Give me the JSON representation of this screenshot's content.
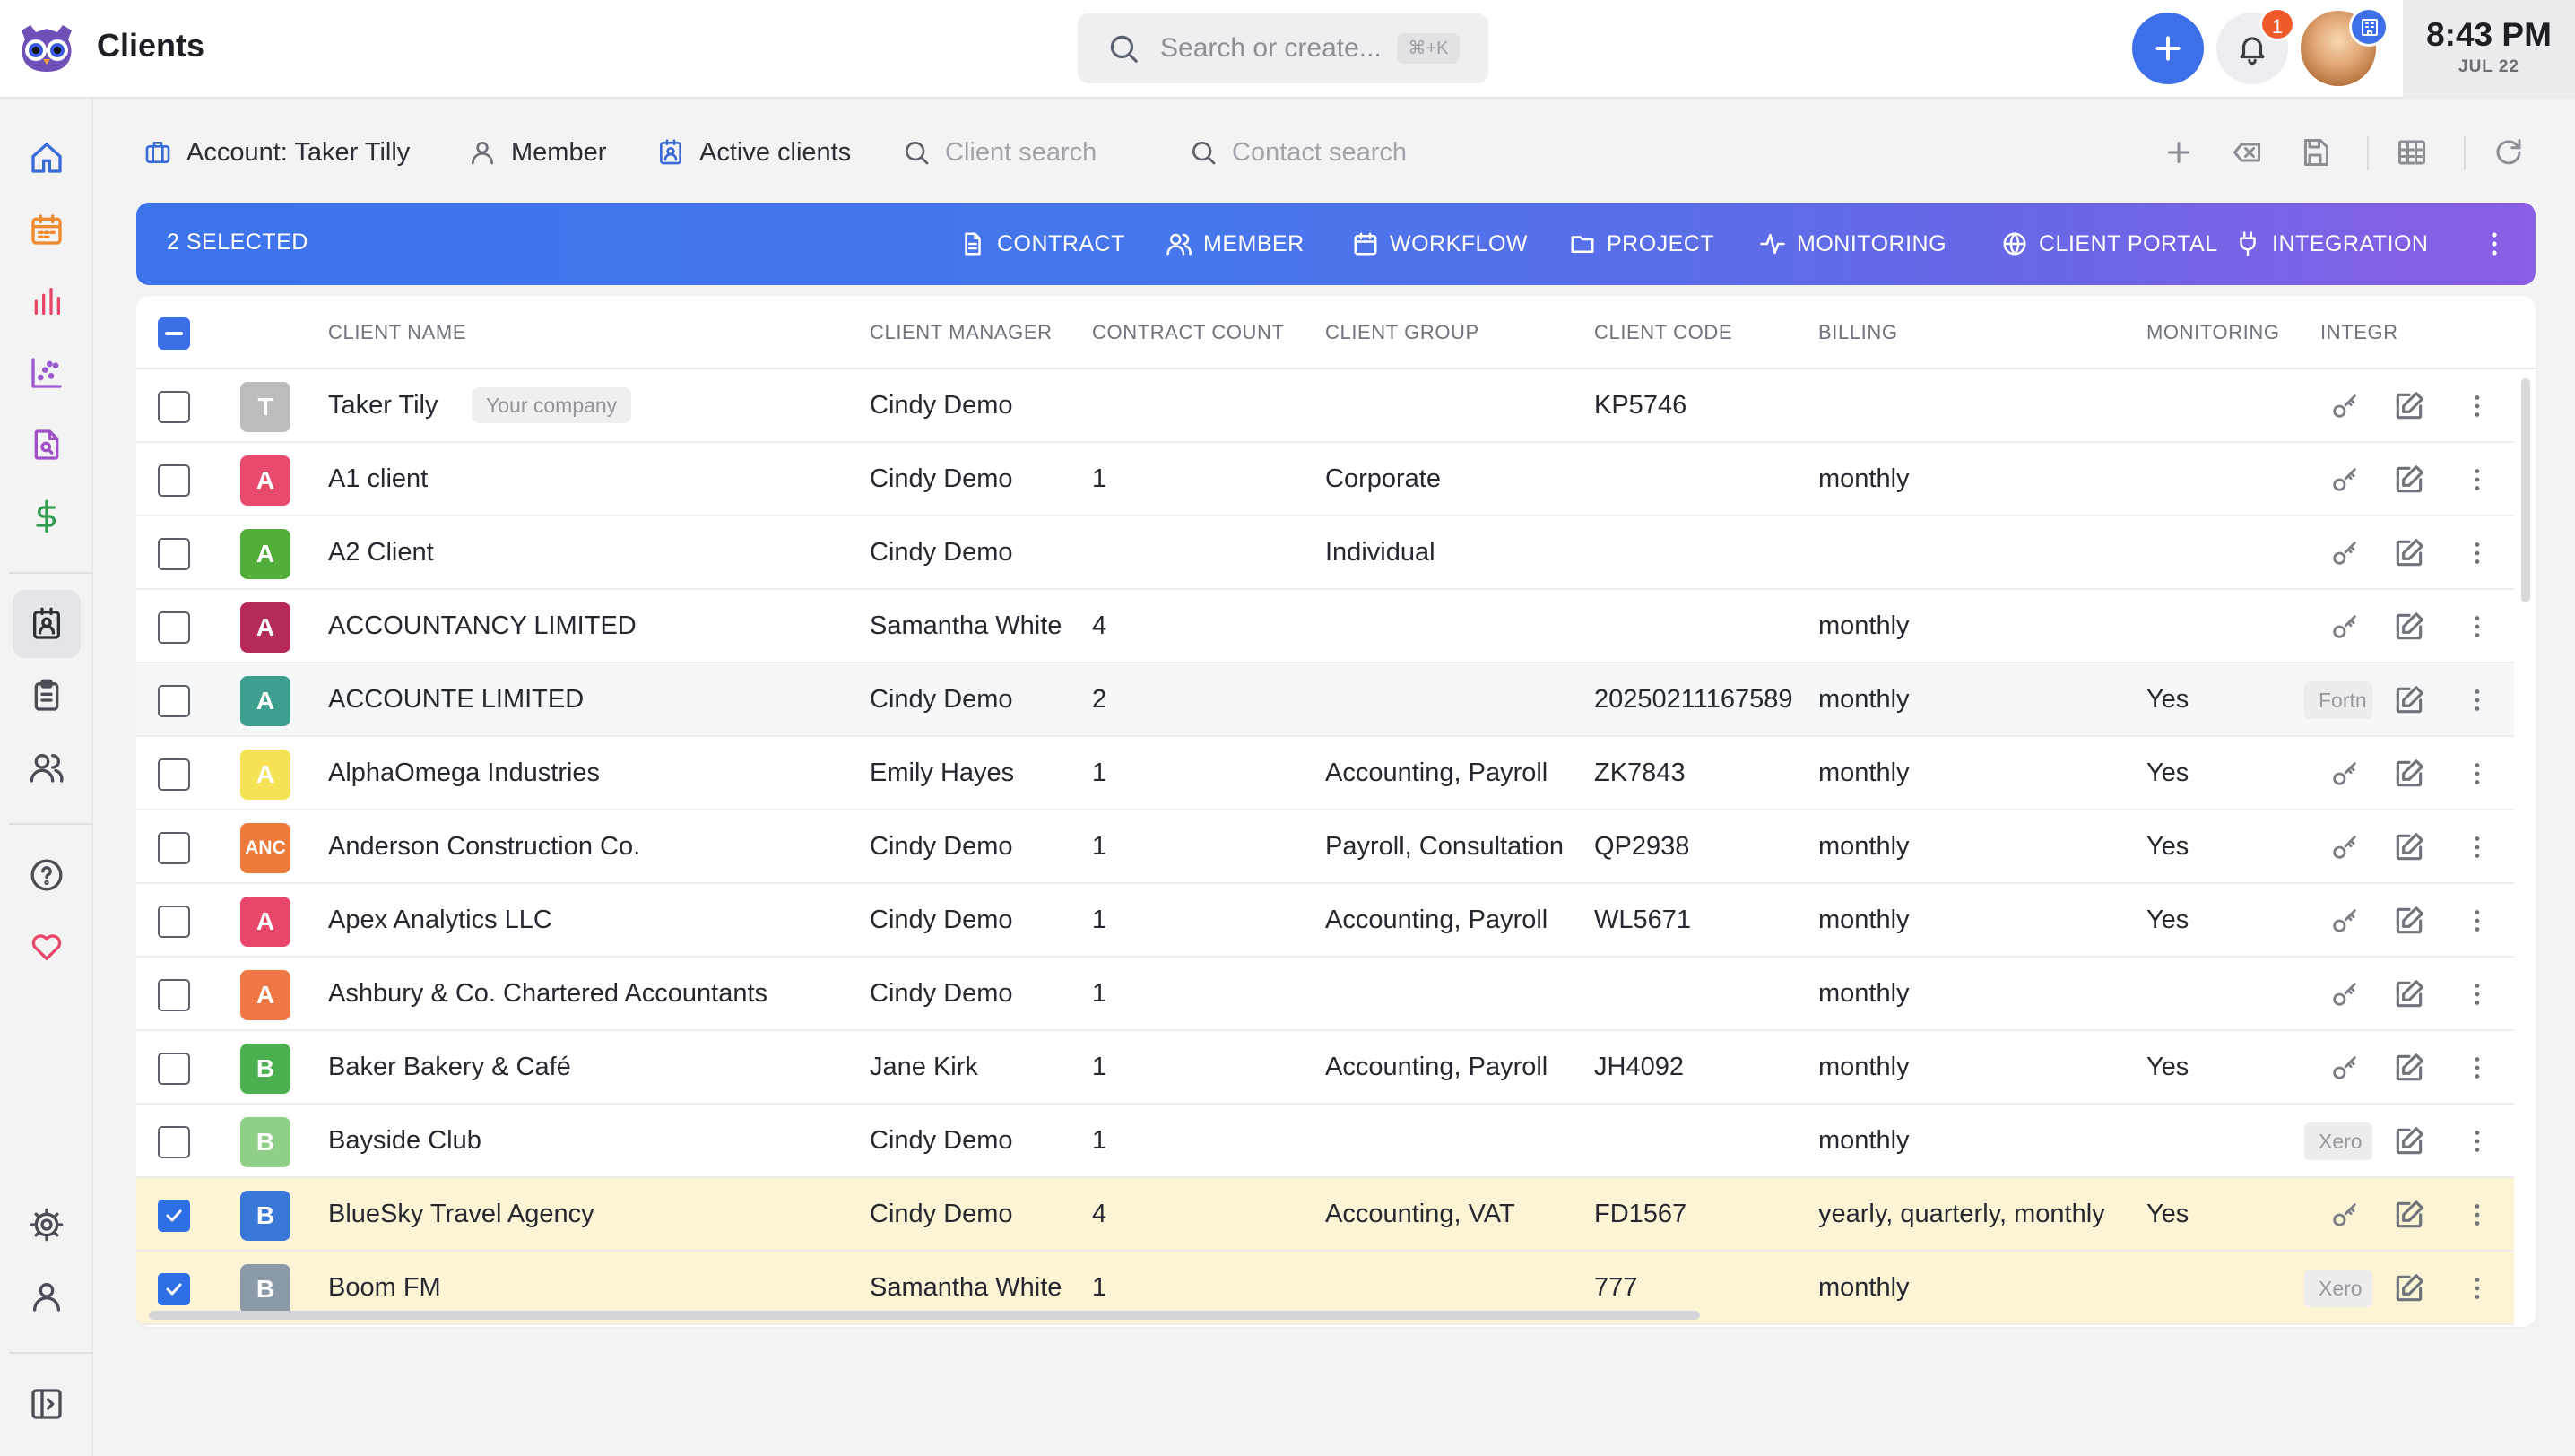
{
  "header": {
    "title": "Clients",
    "search_placeholder": "Search or create...",
    "search_shortcut": "⌘+K",
    "notification_count": "1",
    "time": "8:43 PM",
    "date": "JUL 22"
  },
  "sidebar": {
    "items": [
      "home-icon",
      "calendar-icon",
      "bar-chart-icon",
      "scatter-chart-icon",
      "document-search-icon",
      "dollar-icon",
      "clients-icon",
      "clipboard-icon",
      "users-icon",
      "help-icon",
      "heart-icon",
      "settings-icon",
      "user-icon",
      "sidebar-toggle-icon"
    ],
    "active": "clients-icon"
  },
  "filters": {
    "account": "Account: Taker Tilly",
    "member": "Member",
    "status": "Active clients",
    "client_search": "Client search",
    "contact_search": "Contact search"
  },
  "actionbar": {
    "selected": "2 SELECTED",
    "actions": [
      "CONTRACT",
      "MEMBER",
      "WORKFLOW",
      "PROJECT",
      "MONITORING",
      "CLIENT PORTAL",
      "INTEGRATION"
    ]
  },
  "table": {
    "columns": [
      "CLIENT NAME",
      "CLIENT MANAGER",
      "CONTRACT COUNT",
      "CLIENT GROUP",
      "CLIENT CODE",
      "BILLING",
      "MONITORING",
      "INTEGR"
    ],
    "rows": [
      {
        "initial": "T",
        "color": "#bdbdbd",
        "name": "Taker Tily",
        "tag": "Your company",
        "manager": "Cindy Demo",
        "count": "",
        "group": "",
        "code": "KP5746",
        "billing": "",
        "monitoring": "",
        "integration": "",
        "checked": false
      },
      {
        "initial": "A",
        "color": "#e84a6c",
        "name": "A1 client",
        "tag": "",
        "manager": "Cindy Demo",
        "count": "1",
        "group": "Corporate",
        "code": "",
        "billing": "monthly",
        "monitoring": "",
        "integration": "",
        "checked": false
      },
      {
        "initial": "A",
        "color": "#53ad3a",
        "name": "A2 Client",
        "tag": "",
        "manager": "Cindy Demo",
        "count": "",
        "group": "Individual",
        "code": "",
        "billing": "",
        "monitoring": "",
        "integration": "",
        "checked": false
      },
      {
        "initial": "A",
        "color": "#b52a57",
        "name": "ACCOUNTANCY LIMITED",
        "tag": "",
        "manager": "Samantha White",
        "count": "4",
        "group": "",
        "code": "",
        "billing": "monthly",
        "monitoring": "",
        "integration": "",
        "checked": false
      },
      {
        "initial": "A",
        "color": "#3e9f8f",
        "name": "ACCOUNTE LIMITED",
        "tag": "",
        "manager": "Cindy Demo",
        "count": "2",
        "group": "",
        "code": "20250211167589",
        "billing": "monthly",
        "monitoring": "Yes",
        "integration": "Fortn",
        "checked": false
      },
      {
        "initial": "A",
        "color": "#f5e255",
        "name": "AlphaOmega Industries",
        "tag": "",
        "manager": "Emily Hayes",
        "count": "1",
        "group": "Accounting, Payroll",
        "code": "ZK7843",
        "billing": "monthly",
        "monitoring": "Yes",
        "integration": "",
        "checked": false
      },
      {
        "initial": "ANC",
        "color": "#ec7a3b",
        "name": "Anderson Construction Co.",
        "tag": "",
        "manager": "Cindy Demo",
        "count": "1",
        "group": "Payroll, Consultation",
        "code": "QP2938",
        "billing": "monthly",
        "monitoring": "Yes",
        "integration": "",
        "checked": false
      },
      {
        "initial": "A",
        "color": "#e8476a",
        "name": "Apex Analytics LLC",
        "tag": "",
        "manager": "Cindy Demo",
        "count": "1",
        "group": "Accounting, Payroll",
        "code": "WL5671",
        "billing": "monthly",
        "monitoring": "Yes",
        "integration": "",
        "checked": false
      },
      {
        "initial": "A",
        "color": "#ef7745",
        "name": "Ashbury & Co. Chartered Accountants",
        "tag": "",
        "manager": "Cindy Demo",
        "count": "1",
        "group": "",
        "code": "",
        "billing": "monthly",
        "monitoring": "",
        "integration": "",
        "checked": false
      },
      {
        "initial": "B",
        "color": "#4caf50",
        "name": "Baker Bakery & Café",
        "tag": "",
        "manager": "Jane Kirk",
        "count": "1",
        "group": "Accounting, Payroll",
        "code": "JH4092",
        "billing": "monthly",
        "monitoring": "Yes",
        "integration": "",
        "checked": false
      },
      {
        "initial": "B",
        "color": "#8fcf88",
        "name": "Bayside Club",
        "tag": "",
        "manager": "Cindy Demo",
        "count": "1",
        "group": "",
        "code": "",
        "billing": "monthly",
        "monitoring": "",
        "integration": "Xero",
        "checked": false
      },
      {
        "initial": "B",
        "color": "#3a78d8",
        "name": "BlueSky Travel Agency",
        "tag": "",
        "manager": "Cindy Demo",
        "count": "4",
        "group": "Accounting, VAT",
        "code": "FD1567",
        "billing": "yearly, quarterly, monthly",
        "monitoring": "Yes",
        "integration": "",
        "checked": true
      },
      {
        "initial": "B",
        "color": "#8c9aa8",
        "name": "Boom FM",
        "tag": "",
        "manager": "Samantha White",
        "count": "1",
        "group": "",
        "code": "777",
        "billing": "monthly",
        "monitoring": "",
        "integration": "Xero",
        "checked": true
      }
    ]
  }
}
